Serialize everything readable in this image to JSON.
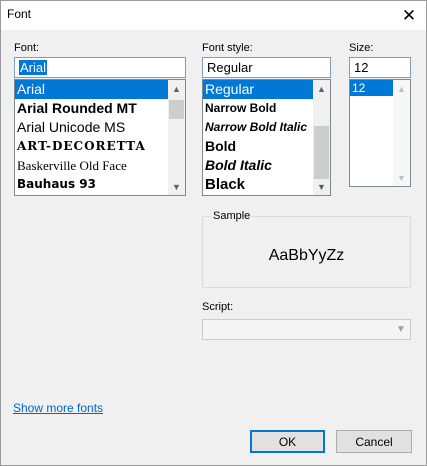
{
  "window": {
    "title": "Font"
  },
  "font": {
    "label": "Font:",
    "value": "Arial",
    "items": [
      {
        "label": "Arial",
        "selected": true
      },
      {
        "label": "Arial Rounded MT"
      },
      {
        "label": "Arial Unicode MS"
      },
      {
        "label": "ART-DECORETTA"
      },
      {
        "label": "Baskerville Old Face"
      },
      {
        "label": "Bauhaus 93"
      }
    ]
  },
  "style": {
    "label": "Font style:",
    "value": "Regular",
    "items": [
      {
        "label": "Regular",
        "selected": true
      },
      {
        "label": "Narrow Bold"
      },
      {
        "label": "Narrow Bold Italic"
      },
      {
        "label": "Bold"
      },
      {
        "label": "Bold Italic"
      },
      {
        "label": "Black"
      }
    ]
  },
  "size": {
    "label": "Size:",
    "value": "12",
    "items": [
      {
        "label": "12",
        "selected": true
      }
    ]
  },
  "sample": {
    "label": "Sample",
    "text": "AaBbYyZz"
  },
  "script": {
    "label": "Script:",
    "value": ""
  },
  "links": {
    "show_more_fonts": "Show more fonts"
  },
  "buttons": {
    "ok": "OK",
    "cancel": "Cancel"
  },
  "colors": {
    "accent": "#0078d7",
    "link": "#0066cc"
  },
  "icons": {
    "close": "close-icon",
    "scroll_up": "chevron-up-icon",
    "scroll_down": "chevron-down-icon",
    "dropdown": "chevron-down-icon"
  }
}
